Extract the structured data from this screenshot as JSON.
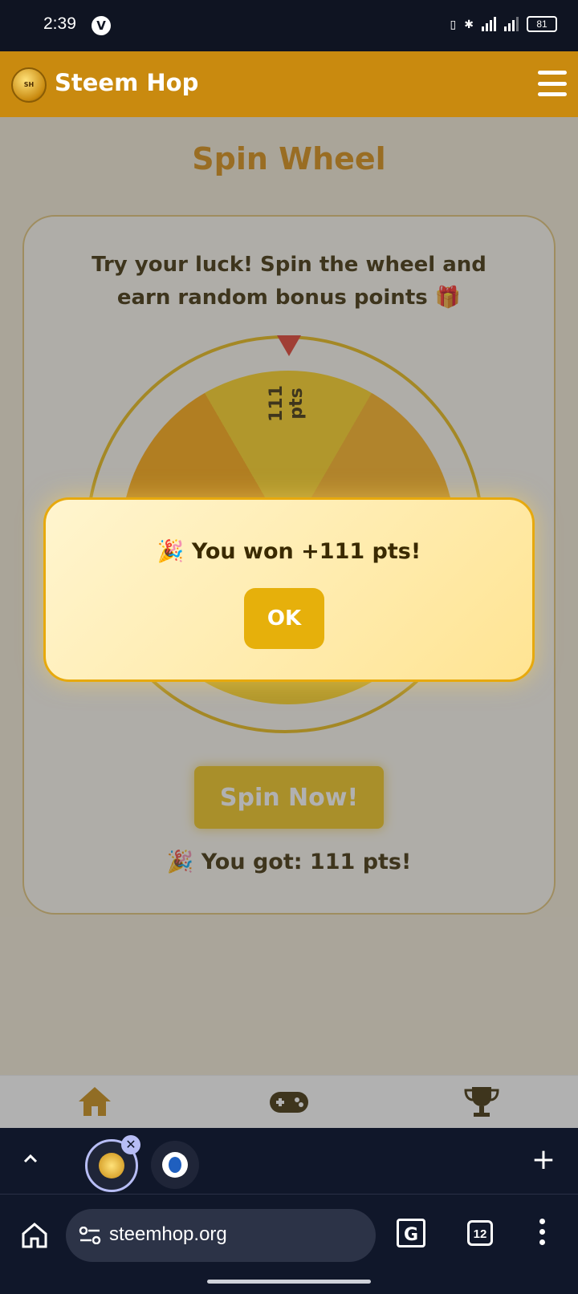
{
  "status_bar": {
    "time": "2:39",
    "battery": "81"
  },
  "app": {
    "title": "Steem Hop"
  },
  "page": {
    "title": "Spin Wheel",
    "intro": "Try your luck! Spin the wheel and earn random bonus points 🎁",
    "wheel_label_top": "111 pts",
    "wheel_label_left": "",
    "wheel_label_right": "",
    "spin_button": "Spin Now!",
    "result": "🎉 You got: 111 pts!"
  },
  "modal": {
    "message": "🎉 You won +111 pts!",
    "ok_label": "OK"
  },
  "bottom_nav": {
    "items": [
      "home-icon",
      "gamepad-icon",
      "trophy-icon"
    ]
  },
  "browser": {
    "url": "steemhop.org",
    "tab_count": "12"
  },
  "colors": {
    "brand": "#c98a0f",
    "title": "#d68b0c",
    "button": "#f2c418",
    "modal_border": "#e7a90d"
  }
}
